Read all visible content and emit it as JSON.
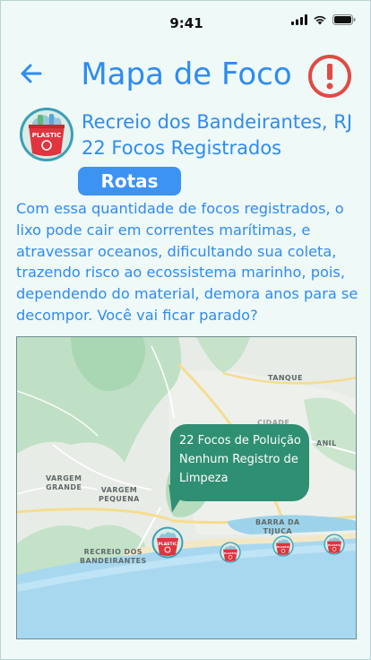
{
  "status_bar": {
    "time": "9:41"
  },
  "header": {
    "title": "Mapa de Foco",
    "back_icon": "arrow-left-icon",
    "alert_icon": "exclamation-circle-icon",
    "title_color": "#2f8bf0",
    "alert_color": "#e04b45"
  },
  "location": {
    "name": "Recreio dos Bandeirantes, RJ",
    "focus_count": "22 Focos Registrados",
    "avatar_label": "PLASTIC",
    "routes_button": "Rotas"
  },
  "description": "Com essa quantidade de focos registrados, o lixo pode cair em correntes marítimas, e atravessar oceanos, dificultando sua coleta, trazendo risco ao ecossistema marinho, pois, dependendo do material, demora anos para se decompor. Você vai ficar parado?",
  "map": {
    "labels": {
      "tanque": "TANQUE",
      "anil": "ANIL",
      "cidade": "CIDADE",
      "vargem_grande_1": "VARGEM",
      "vargem_grande_2": "GRANDE",
      "vargem_pequena_1": "VARGEM",
      "vargem_pequena_2": "PEQUENA",
      "barra_1": "BARRA DA",
      "barra_2": "TIJUCA",
      "recreio_1": "RECREIO DOS",
      "recreio_2": "BANDEIRANTES"
    },
    "tooltip": {
      "line1": "22 Focos de Poluição",
      "line2": "Nenhum Registro de",
      "line3": "Limpeza"
    },
    "marker_label": "PLASTIC"
  }
}
